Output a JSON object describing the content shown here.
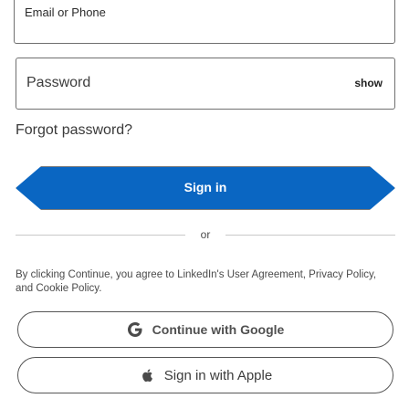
{
  "email": {
    "label": "Email or Phone"
  },
  "password": {
    "label": "Password",
    "show_label": "show"
  },
  "forgot_label": "Forgot password?",
  "signin_label": "Sign in",
  "divider_label": "or",
  "legal_text": "By clicking Continue, you agree to LinkedIn's User Agreement, Privacy Policy, and Cookie Policy.",
  "google_label": "Continue with Google",
  "apple_label": "Sign in with Apple",
  "colors": {
    "accent": "#0a66c2",
    "border": "#6f6f6f",
    "text": "#1f1f1f"
  },
  "icons": {
    "google": "google-icon",
    "apple": "apple-icon"
  }
}
